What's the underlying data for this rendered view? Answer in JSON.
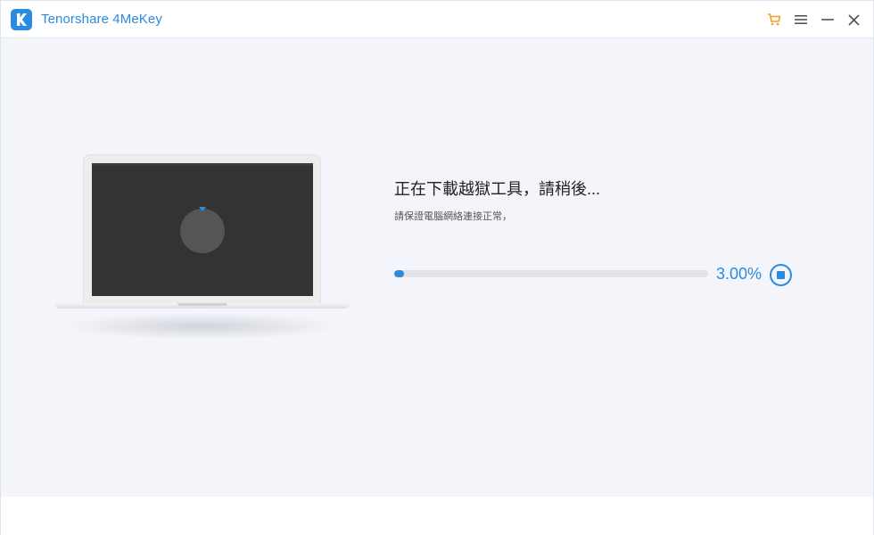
{
  "window": {
    "title": "Tenorshare 4MeKey"
  },
  "titlebar": {
    "icons": [
      "cart-icon",
      "menu-icon",
      "minimize-icon",
      "close-icon"
    ]
  },
  "status": {
    "title": "正在下載越獄工具，請稍後...",
    "subtitle": "請保證電腦網絡連接正常，"
  },
  "progress": {
    "value": 0.03,
    "label": "3.00%"
  },
  "colors": {
    "accent": "#2a8ce0",
    "background": "#f4f5fa",
    "cart": "#f0a020"
  }
}
